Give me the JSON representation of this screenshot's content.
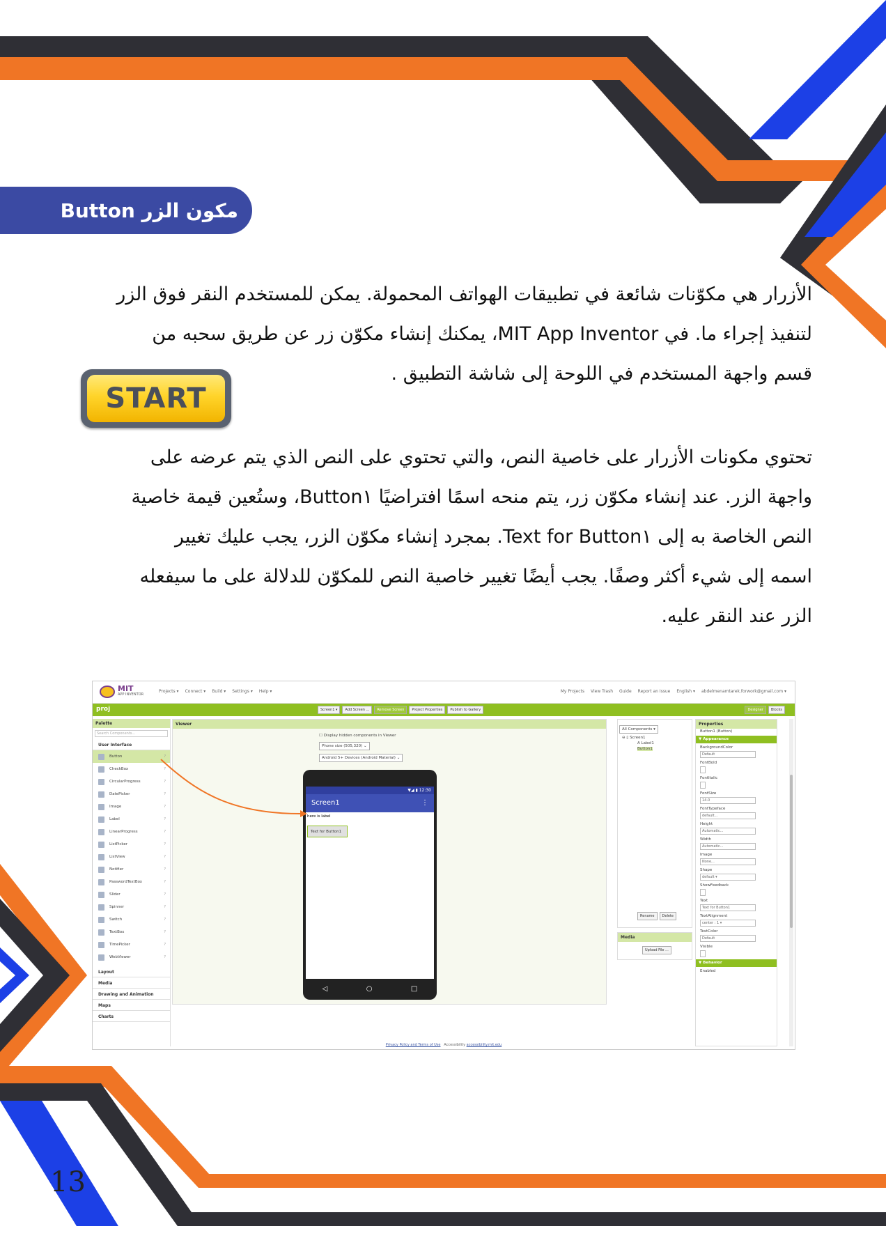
{
  "section_title": "مكون الزر Button",
  "paragraph1": {
    "line1": "الأزرار هي مكوّنات شائعة في تطبيقات الهواتف المحمولة. يمكن للمستخدم النقر فوق الزر",
    "line2": "لتنفيذ إجراء ما. في MIT App Inventor، يمكنك إنشاء مكوّن زر عن طريق سحبه من",
    "line3": "قسم واجهة المستخدم في اللوحة إلى شاشة التطبيق ."
  },
  "paragraph2": {
    "line1": "تحتوي مكونات الأزرار على خاصية النص، والتي تحتوي على النص الذي يتم عرضه على",
    "line2": "واجهة الزر. عند إنشاء مكوّن زر، يتم منحه اسمًا افتراضيًا Button١، وستُعين قيمة خاصية",
    "line3": "النص الخاصة به إلى Text for Button١. بمجرد إنشاء مكوّن الزر، يجب عليك تغيير",
    "line4": "اسمه إلى شيء أكثر وصفًا. يجب أيضًا تغيير خاصية النص للمكوّن للدلالة على ما سيفعله",
    "line5": "الزر عند النقر عليه."
  },
  "start_button_label": "START",
  "page_number": "13",
  "screenshot": {
    "logo": {
      "title": "MIT",
      "subtitle": "APP INVENTOR"
    },
    "menu": [
      "Projects ▾",
      "Connect ▾",
      "Build ▾",
      "Settings ▾",
      "Help ▾"
    ],
    "right_menu": [
      "My Projects",
      "View Trash",
      "Guide",
      "Report an Issue",
      "English ▾",
      "abdelmenamtarek.forwork@gmail.com ▾"
    ],
    "project_name": "proj",
    "toolbar": [
      "Screen1 ▾",
      "Add Screen ...",
      "Remove Screen",
      "Project Properties",
      "Publish to Gallery"
    ],
    "mode_buttons": [
      "Designer",
      "Blocks"
    ],
    "palette": {
      "header": "Palette",
      "search_placeholder": "Search Components...",
      "category": "User Interface",
      "items": [
        "Button",
        "CheckBox",
        "CircularProgress",
        "DatePicker",
        "Image",
        "Label",
        "LinearProgress",
        "ListPicker",
        "ListView",
        "Notifier",
        "PasswordTextBox",
        "Slider",
        "Spinner",
        "Switch",
        "TextBox",
        "TimePicker",
        "WebViewer"
      ],
      "other_categories": [
        "Layout",
        "Media",
        "Drawing and Animation",
        "Maps",
        "Charts"
      ]
    },
    "viewer": {
      "header": "Viewer",
      "hidden_checkbox": "Display hidden components in Viewer",
      "phone_size": "Phone size (505,320)",
      "theme": "Android 5+ Devices (Android Material)",
      "status_time": "12:30",
      "screen_title": "Screen1",
      "label_text": "here is label",
      "button_text": "Text for Button1"
    },
    "components": {
      "dropdown": "All Components ▾",
      "tree": [
        "Screen1",
        "Label1",
        "Button1"
      ],
      "rename": "Rename",
      "delete": "Delete",
      "media_header": "Media",
      "upload": "Upload File ..."
    },
    "properties": {
      "header": "Properties",
      "subject": "Button1 (Button)",
      "appearance": "▼ Appearance",
      "items": [
        {
          "name": "BackgroundColor",
          "value": "Default"
        },
        {
          "name": "FontBold",
          "value": ""
        },
        {
          "name": "FontItalic",
          "value": ""
        },
        {
          "name": "FontSize",
          "value": "14.0"
        },
        {
          "name": "FontTypeface",
          "value": "default..."
        },
        {
          "name": "Height",
          "value": "Automatic..."
        },
        {
          "name": "Width",
          "value": "Automatic..."
        },
        {
          "name": "Image",
          "value": "None..."
        },
        {
          "name": "Shape",
          "value": "default ▾"
        },
        {
          "name": "ShowFeedback",
          "value": ""
        },
        {
          "name": "Text",
          "value": "Text for Button1"
        },
        {
          "name": "TextAlignment",
          "value": "center : 1 ▾"
        },
        {
          "name": "TextColor",
          "value": "Default"
        },
        {
          "name": "Visible",
          "value": ""
        }
      ],
      "behavior": "▼ Behavior",
      "enabled": "Enabled"
    },
    "footer": {
      "privacy": "Privacy Policy and Terms of Use",
      "accessibility": "Accessibility",
      "email": "accessibility.mit.edu"
    }
  },
  "colors": {
    "orange": "#f07525",
    "blue": "#1c40e6",
    "dark": "#2f2f35",
    "pill": "#3b4aa3"
  }
}
